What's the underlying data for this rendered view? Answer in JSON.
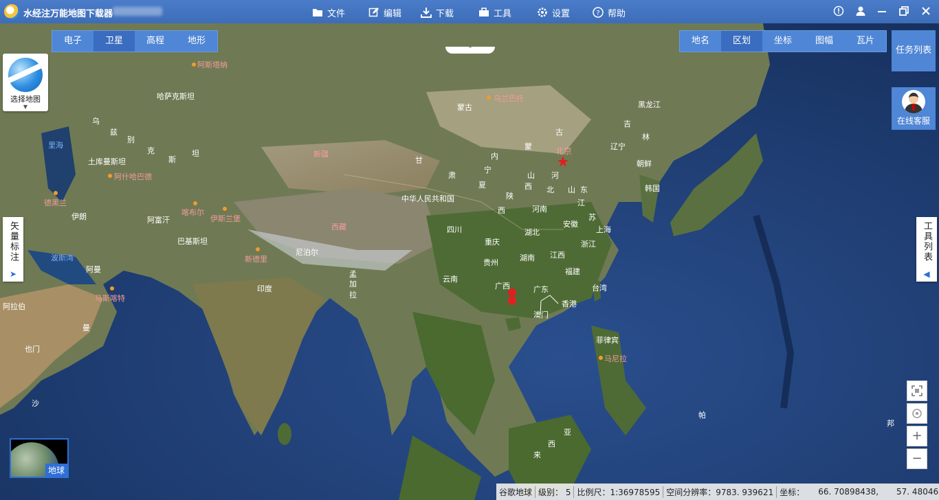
{
  "app": {
    "title": "水经注万能地图下载器"
  },
  "menu": [
    {
      "label": "文件",
      "icon": "folder-icon"
    },
    {
      "label": "编辑",
      "icon": "edit-icon"
    },
    {
      "label": "下载",
      "icon": "download-icon"
    },
    {
      "label": "工具",
      "icon": "toolbox-icon"
    },
    {
      "label": "设置",
      "icon": "gear-icon"
    },
    {
      "label": "帮助",
      "icon": "help-icon"
    }
  ],
  "window_controls": [
    "info-icon",
    "user-icon",
    "minimize-icon",
    "restore-icon",
    "close-icon"
  ],
  "map_type_tabs": {
    "items": [
      "电子",
      "卫星",
      "高程",
      "地形"
    ],
    "active": "卫星"
  },
  "layer_tabs": {
    "items": [
      "地名",
      "区划",
      "坐标",
      "图幅",
      "瓦片"
    ],
    "active": "区划"
  },
  "select_map": {
    "label": "选择地图"
  },
  "task_list": {
    "label": "任务列表"
  },
  "online_service": {
    "label": "在线客服"
  },
  "vector_annotation": {
    "label": "矢量标注"
  },
  "tool_list": {
    "label": "工具列表"
  },
  "earth_thumbnail": {
    "label": "地球"
  },
  "zoom_controls": {
    "fullscreen": "fullscreen-icon",
    "locate": "locate-icon",
    "zoom_in": "+",
    "zoom_out": "−"
  },
  "status": {
    "source": "谷歌地球",
    "level": "级别： 5",
    "scale": "比例尺：1:36978595",
    "resolution": "空间分辨率：9783. 939621",
    "coords_label": "坐标：",
    "lon": "66. 70898438,",
    "lat": "57. 4804687"
  },
  "labels": {
    "white": [
      "哈萨克斯坦",
      "乌",
      "兹",
      "别",
      "克",
      "斯",
      "坦",
      "土库曼斯坦",
      "伊朗",
      "阿富汗",
      "巴基斯坦",
      "尼泊尔",
      "印度",
      "阿曼",
      "也门",
      "孟",
      "加",
      "拉",
      "蒙古",
      "中华人民共和国",
      "黑龙江",
      "吉",
      "林",
      "辽宁",
      "朝鲜",
      "韩国",
      "内",
      "蒙",
      "古",
      "宁",
      "夏",
      "甘",
      "肃",
      "陕",
      "西",
      "山",
      "西",
      "河",
      "北",
      "山",
      "东",
      "河南",
      "江",
      "苏",
      "安徽",
      "上海",
      "四川",
      "湖北",
      "浙江",
      "重庆",
      "贵州",
      "湖南",
      "江西",
      "福建",
      "云南",
      "广西",
      "广东",
      "台湾",
      "香港",
      "澳门",
      "菲律宾",
      "亚",
      "西",
      "来",
      "帕",
      "邦",
      "阿拉伯",
      "曼",
      "沙"
    ],
    "blue": [
      "里海",
      "波斯湾"
    ],
    "pink": [
      "阿斯塔纳",
      "乌兰巴托",
      "新疆",
      "阿什哈巴德",
      "德黑兰",
      "喀布尔",
      "伊斯兰堡",
      "西藏",
      "新德里",
      "马斯喀特",
      "北京",
      "马尼拉"
    ]
  },
  "colors": {
    "toolbar_blue": "#4f86d6",
    "accent": "#2f6fd6",
    "marker_red": "#e02020"
  }
}
